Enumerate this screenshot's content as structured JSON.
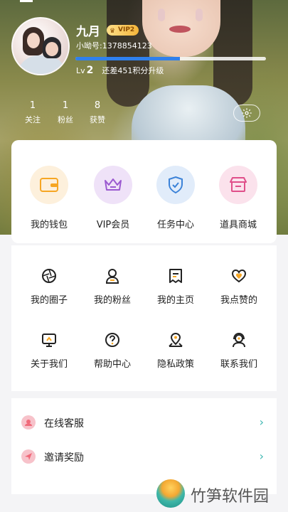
{
  "profile": {
    "name": "九月",
    "vip_label": "VIP2",
    "account": "小呦号:1378854123",
    "level_prefix": "Lv",
    "level_num": "2",
    "level_remain": "还差451积分升级",
    "level_progress": 0.55
  },
  "stats": [
    {
      "value": "1",
      "label": "关注"
    },
    {
      "value": "1",
      "label": "粉丝"
    },
    {
      "value": "8",
      "label": "获赞"
    }
  ],
  "quick": [
    {
      "label": "我的钱包",
      "icon": "wallet-icon",
      "color": "#f6a623",
      "bg": "#fdf0dc"
    },
    {
      "label": "VIP会员",
      "icon": "crown-icon",
      "color": "#9b59d0",
      "bg": "#efe2f8"
    },
    {
      "label": "任务中心",
      "icon": "shield-check-icon",
      "color": "#3b82d8",
      "bg": "#e1ecfa"
    },
    {
      "label": "道具商城",
      "icon": "store-icon",
      "color": "#e04f8a",
      "bg": "#fbe2ec"
    }
  ],
  "grid": [
    {
      "label": "我的圈子",
      "icon": "aperture-icon"
    },
    {
      "label": "我的粉丝",
      "icon": "user-icon"
    },
    {
      "label": "我的主页",
      "icon": "homepage-icon"
    },
    {
      "label": "我点赞的",
      "icon": "heart-icon"
    },
    {
      "label": "关于我们",
      "icon": "monitor-icon"
    },
    {
      "label": "帮助中心",
      "icon": "help-icon"
    },
    {
      "label": "隐私政策",
      "icon": "location-icon"
    },
    {
      "label": "联系我们",
      "icon": "headset-icon"
    }
  ],
  "list": [
    {
      "label": "在线客服",
      "icon": "support-icon",
      "color": "#f06a7a"
    },
    {
      "label": "邀请奖励",
      "icon": "send-icon",
      "color": "#f06a7a"
    }
  ],
  "watermark": "竹笋软件园"
}
